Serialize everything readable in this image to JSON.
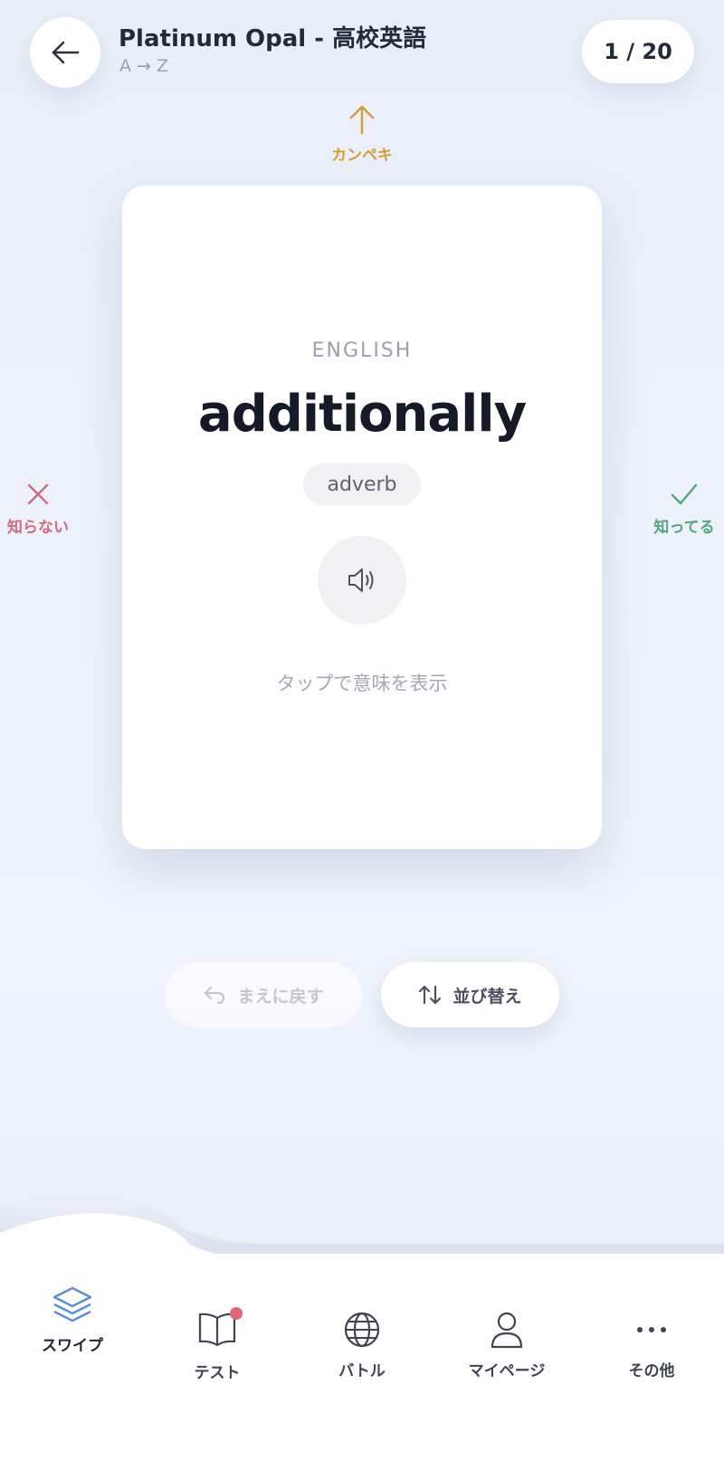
{
  "header": {
    "title": "Platinum Opal - 高校英語",
    "subtitle": "A → Z",
    "counter": "1 / 20"
  },
  "hints": {
    "up_label": "カンペキ",
    "left_label": "知らない",
    "right_label": "知ってる"
  },
  "card": {
    "language": "ENGLISH",
    "word": "additionally",
    "part_of_speech": "adverb",
    "tap_hint": "タップで意味を表示"
  },
  "actions": {
    "undo_label": "まえに戻す",
    "sort_label": "並び替え"
  },
  "nav": {
    "items": [
      {
        "label": "スワイプ",
        "icon": "layers-icon",
        "active": true
      },
      {
        "label": "テスト",
        "icon": "book-icon",
        "badge": true
      },
      {
        "label": "バトル",
        "icon": "globe-icon"
      },
      {
        "label": "マイページ",
        "icon": "user-icon"
      },
      {
        "label": "その他",
        "icon": "more-icon"
      }
    ]
  },
  "colors": {
    "perfect": "#d2a032",
    "unknown": "#d36a7c",
    "known": "#4fa87b",
    "active_nav": "#5b8fd8",
    "badge": "#e06677"
  }
}
